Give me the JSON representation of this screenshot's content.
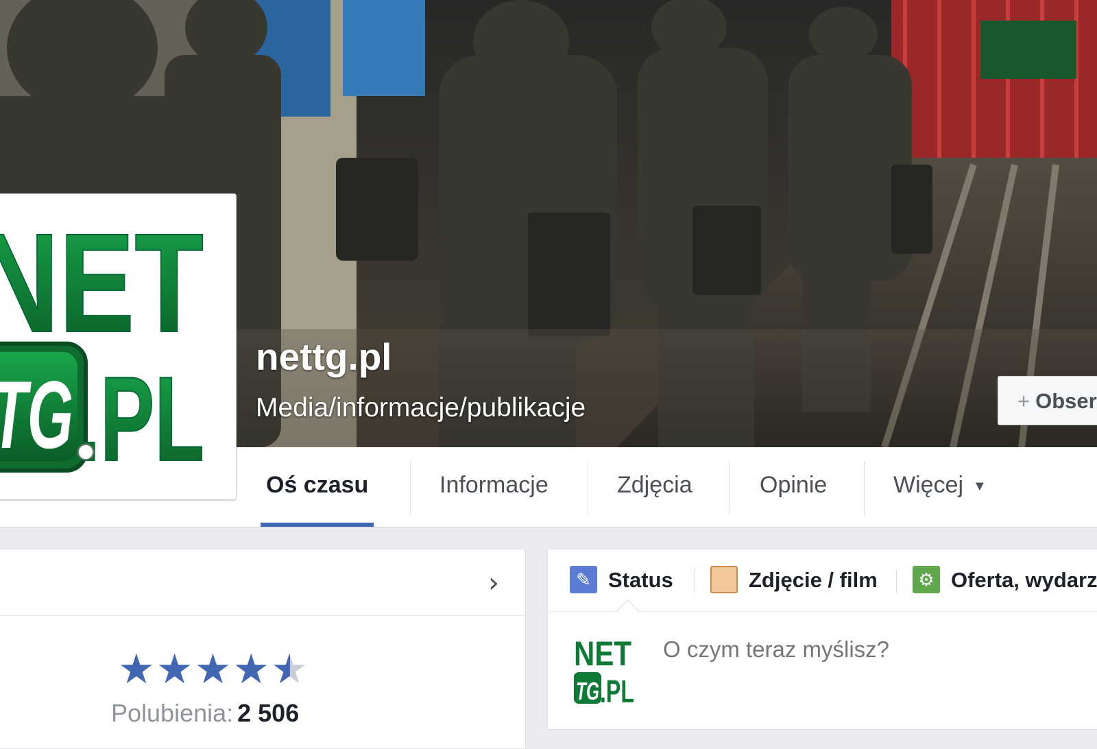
{
  "page": {
    "name": "nettg.pl",
    "category": "Media/informacje/publikacje",
    "logo_text_top": "NET",
    "logo_text_badge": "TG",
    "logo_text_bottom": ".PL"
  },
  "actions": {
    "follow_label": "Obserwuj"
  },
  "tabs": [
    {
      "label": "Oś czasu",
      "active": true
    },
    {
      "label": "Informacje",
      "active": false
    },
    {
      "label": "Zdjęcia",
      "active": false
    },
    {
      "label": "Opinie",
      "active": false
    },
    {
      "label": "Więcej",
      "active": false
    }
  ],
  "rating": {
    "stars": 4.5,
    "likes_label": "Polubienia:",
    "likes_count": "2 506"
  },
  "composer": {
    "tabs": [
      {
        "label": "Status",
        "icon": "pencil-icon"
      },
      {
        "label": "Zdjęcie / film",
        "icon": "photo-icon"
      },
      {
        "label": "Oferta, wydarzenie",
        "icon": "gear-icon"
      }
    ],
    "placeholder": "O czym teraz myślisz?"
  },
  "colors": {
    "accent": "#4267b2",
    "logo_green": "#0a7a35"
  }
}
